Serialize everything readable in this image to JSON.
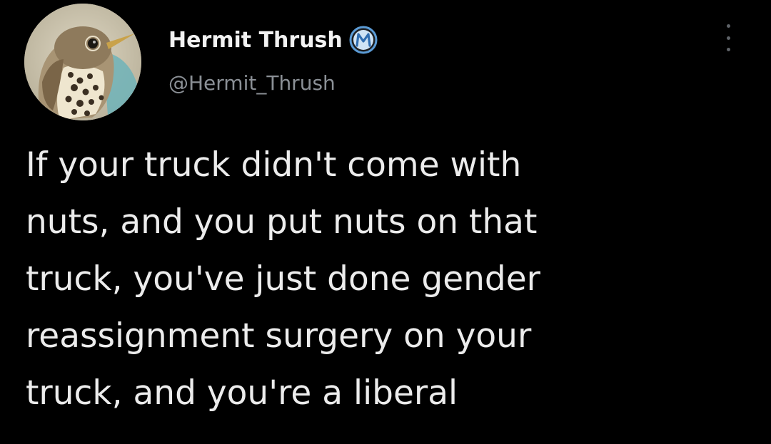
{
  "author": {
    "display_name": "Hermit Thrush",
    "handle": "@Hermit_Thrush",
    "badge_icon": "m-circle-badge-icon",
    "badge_letter": "M",
    "badge_color": "#5b9bd5"
  },
  "avatar": {
    "icon": "thrush-bird-avatar"
  },
  "menu": {
    "icon": "more-vertical-icon"
  },
  "tweet": {
    "lines": [
      "If your truck didn't come with",
      "nuts, and you put nuts on that",
      "truck, you've just done gender",
      "reassignment surgery on your",
      "truck, and you're a liberal"
    ]
  },
  "colors": {
    "background": "#000000",
    "text": "#ececec",
    "secondary_text": "#8b9096"
  }
}
